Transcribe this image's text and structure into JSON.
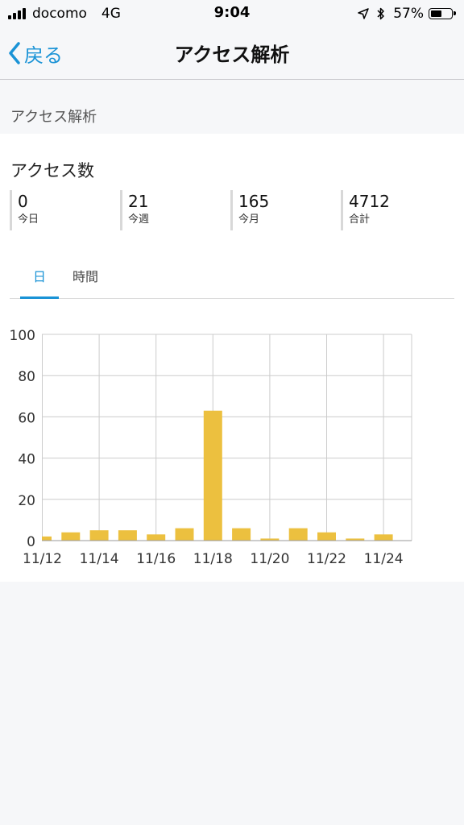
{
  "status_bar": {
    "carrier": "docomo",
    "network": "4G",
    "time": "9:04",
    "battery": "57%",
    "battery_level": 0.57,
    "icons": [
      "signal-bars-icon",
      "location-arrow-icon",
      "bluetooth-icon",
      "battery-icon"
    ]
  },
  "nav": {
    "back_label": "戻る",
    "title": "アクセス解析"
  },
  "section": {
    "header": "アクセス解析"
  },
  "card": {
    "title": "アクセス数",
    "stats": [
      {
        "value": "0",
        "label": "今日"
      },
      {
        "value": "21",
        "label": "今週"
      },
      {
        "value": "165",
        "label": "今月"
      },
      {
        "value": "4712",
        "label": "合計"
      }
    ],
    "tabs": [
      {
        "label": "日",
        "active": true
      },
      {
        "label": "時間",
        "active": false
      }
    ]
  },
  "colors": {
    "accent": "#1a93d6",
    "bar": "#ecc03f",
    "grid": "#cccccc"
  },
  "chart_data": {
    "type": "bar",
    "categories": [
      "11/12",
      "11/13",
      "11/14",
      "11/15",
      "11/16",
      "11/17",
      "11/18",
      "11/19",
      "11/20",
      "11/21",
      "11/22",
      "11/23",
      "11/24"
    ],
    "tick_labels": [
      "11/12",
      "11/14",
      "11/16",
      "11/18",
      "11/20",
      "11/22",
      "11/24"
    ],
    "values": [
      2,
      4,
      5,
      5,
      3,
      6,
      63,
      6,
      1,
      6,
      4,
      1,
      3
    ],
    "yticks": [
      0,
      20,
      40,
      60,
      80,
      100
    ],
    "ylim": [
      0,
      100
    ],
    "grid": true,
    "legend": "none"
  }
}
